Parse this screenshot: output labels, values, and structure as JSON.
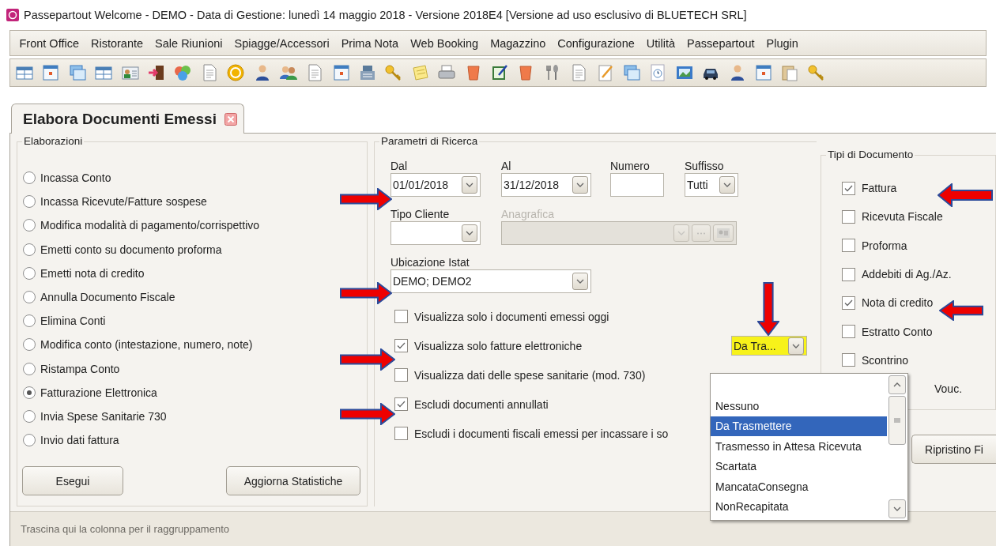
{
  "window": {
    "title": "Passepartout Welcome - DEMO - Data di Gestione: lunedì 14 maggio 2018 - Versione 2018E4 [Versione ad uso esclusivo di BLUETECH SRL]"
  },
  "menu": [
    {
      "label": "Front Office"
    },
    {
      "label": "Ristorante"
    },
    {
      "label": "Sale Riunioni"
    },
    {
      "label": "Spiagge/Accessori"
    },
    {
      "label": "Prima Nota"
    },
    {
      "label": "Web Booking"
    },
    {
      "label": "Magazzino"
    },
    {
      "label": "Configurazione"
    },
    {
      "label": "Utilità"
    },
    {
      "label": "Passepartout"
    },
    {
      "label": "Plugin"
    }
  ],
  "tab": {
    "title": "Elabora Documenti Emessi"
  },
  "elaborazioni": {
    "legend": "Elaborazioni",
    "options": [
      {
        "label": "Incassa Conto",
        "selected": false
      },
      {
        "label": "Incassa Ricevute/Fatture sospese",
        "selected": false
      },
      {
        "label": "Modifica modalità di pagamento/corrispettivo",
        "selected": false
      },
      {
        "label": "Emetti conto su documento proforma",
        "selected": false
      },
      {
        "label": "Emetti nota di credito",
        "selected": false
      },
      {
        "label": "Annulla Documento Fiscale",
        "selected": false
      },
      {
        "label": "Elimina Conti",
        "selected": false
      },
      {
        "label": "Modifica conto (intestazione, numero, note)",
        "selected": false
      },
      {
        "label": "Ristampa Conto",
        "selected": false
      },
      {
        "label": "Fatturazione Elettronica",
        "selected": true
      },
      {
        "label": "Invia Spese Sanitarie 730",
        "selected": false
      },
      {
        "label": "Invio dati fattura",
        "selected": false
      }
    ],
    "buttons": [
      {
        "label": "Esegui"
      },
      {
        "label": "Aggiorna Statistiche"
      }
    ]
  },
  "parametri": {
    "legend": "Parametri di Ricerca",
    "dal": {
      "label": "Dal",
      "value": "01/01/2018"
    },
    "al": {
      "label": "Al",
      "value": "31/12/2018"
    },
    "numero": {
      "label": "Numero"
    },
    "suffisso": {
      "label": "Suffisso",
      "value": "Tutti"
    },
    "tipo_cliente": {
      "label": "Tipo Cliente"
    },
    "anagrafica": {
      "label": "Anagrafica",
      "disabled": true
    },
    "ubicazione": {
      "label": "Ubicazione Istat",
      "value": "DEMO; DEMO2"
    },
    "options": [
      {
        "label": "Visualizza solo i documenti emessi oggi",
        "checked": false
      },
      {
        "label": "Visualizza solo fatture elettroniche",
        "checked": true
      },
      {
        "label": "Visualizza dati delle spese sanitarie (mod. 730)",
        "checked": false
      },
      {
        "label": "Escludi documenti annullati",
        "checked": true
      },
      {
        "label": "Escludi i documenti fiscali emessi per incassare i so",
        "checked": false
      }
    ],
    "stato": {
      "value": "Da Tra...",
      "highlighted": true
    },
    "dropdown": {
      "items": [
        {
          "label": "Nessuno",
          "selected": false
        },
        {
          "label": "Da Trasmettere",
          "selected": true
        },
        {
          "label": "Trasmesso in Attesa Ricevuta",
          "selected": false
        },
        {
          "label": "Scartata",
          "selected": false
        },
        {
          "label": "MancataConsegna",
          "selected": false
        },
        {
          "label": "NonRecapitata",
          "selected": false
        }
      ]
    }
  },
  "tipi_documento": {
    "legend": "Tipi di Documento",
    "items": [
      {
        "kind": "checkbox",
        "label": "Fattura",
        "checked": true
      },
      {
        "kind": "checkbox",
        "label": "Ricevuta Fiscale",
        "checked": false
      },
      {
        "kind": "checkbox",
        "label": "Proforma",
        "checked": false
      },
      {
        "kind": "checkbox",
        "label": "Addebiti di Ag./Az.",
        "checked": false
      },
      {
        "kind": "checkbox",
        "label": "Nota di credito",
        "checked": true
      },
      {
        "kind": "checkbox",
        "label": "Estratto Conto",
        "checked": false
      },
      {
        "kind": "checkbox",
        "label": "Scontrino",
        "checked": false
      },
      {
        "kind": "covered",
        "label": "Vouc."
      }
    ]
  },
  "ripristino_button": {
    "label": "Ripristino Fi"
  },
  "group_bar": {
    "hint": "Trascina qui la colonna per il raggruppamento"
  }
}
